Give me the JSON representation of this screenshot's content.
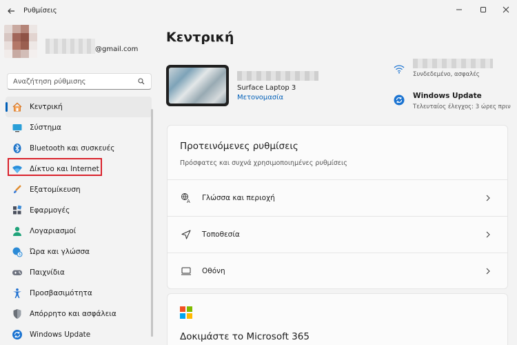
{
  "window": {
    "title": "Ρυθμίσεις"
  },
  "profile": {
    "email_suffix": "@gmail.com"
  },
  "search": {
    "placeholder": "Αναζήτηση ρύθμισης"
  },
  "sidebar": {
    "items": [
      {
        "label": "Κεντρική",
        "icon": "home-icon"
      },
      {
        "label": "Σύστημα",
        "icon": "system-icon"
      },
      {
        "label": "Bluetooth και συσκευές",
        "icon": "bluetooth-icon"
      },
      {
        "label": "Δίκτυο και Internet",
        "icon": "network-icon"
      },
      {
        "label": "Εξατομίκευση",
        "icon": "brush-icon"
      },
      {
        "label": "Εφαρμογές",
        "icon": "apps-icon"
      },
      {
        "label": "Λογαριασμοί",
        "icon": "account-icon"
      },
      {
        "label": "Ώρα και γλώσσα",
        "icon": "time-language-icon"
      },
      {
        "label": "Παιχνίδια",
        "icon": "gamepad-icon"
      },
      {
        "label": "Προσβασιμότητα",
        "icon": "accessibility-icon"
      },
      {
        "label": "Απόρρητο και ασφάλεια",
        "icon": "shield-icon"
      },
      {
        "label": "Windows Update",
        "icon": "windows-update-icon"
      }
    ]
  },
  "main": {
    "title": "Κεντρική",
    "device": {
      "model": "Surface Laptop 3",
      "rename_link": "Μετονομασία"
    },
    "wifi": {
      "status": "Συνδεδεμένο, ασφαλές"
    },
    "windows_update": {
      "title": "Windows Update",
      "status": "Τελευταίος έλεγχος: 3 ώρες πριν"
    },
    "recommended": {
      "title": "Προτεινόμενες ρυθμίσεις",
      "subtitle": "Πρόσφατες και συχνά χρησιμοποιημένες ρυθμίσεις",
      "rows": [
        {
          "label": "Γλώσσα και περιοχή",
          "icon": "language-region-icon"
        },
        {
          "label": "Τοποθεσία",
          "icon": "location-icon"
        },
        {
          "label": "Οθόνη",
          "icon": "display-icon"
        }
      ]
    },
    "microsoft365": {
      "title": "Δοκιμάστε το Microsoft 365"
    }
  },
  "colors": {
    "accent": "#005fb8",
    "highlight_box": "#d9202a",
    "background": "#f3f3f3",
    "card": "#fbfbfb"
  }
}
